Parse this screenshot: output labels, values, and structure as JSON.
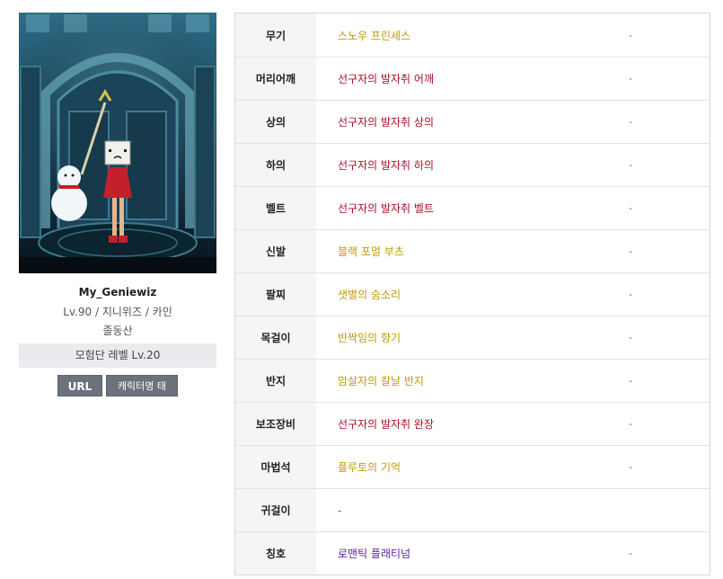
{
  "character": {
    "name": "My_Geniewiz",
    "info": "Lv.90 / 지니위즈 / 카인",
    "server": "졸동산",
    "adventure_level": "모험단 레벨 Lv.20",
    "url_button": "URL",
    "tag_button": "캐릭터명 태그"
  },
  "colors": {
    "unique": "#c19a07",
    "epic": "#a8102a",
    "title": "#5a1fa0"
  },
  "equipment": [
    {
      "slot": "무기",
      "item": "스노우 프린세스",
      "rarity": "unique",
      "extra": "-"
    },
    {
      "slot": "머리어깨",
      "item": "선구자의 발자취 어깨",
      "rarity": "epic",
      "extra": "-"
    },
    {
      "slot": "상의",
      "item": "선구자의 발자취 상의",
      "rarity": "epic",
      "extra": "-"
    },
    {
      "slot": "하의",
      "item": "선구자의 발자취 하의",
      "rarity": "epic",
      "extra": "-"
    },
    {
      "slot": "벨트",
      "item": "선구자의 발자취 벨트",
      "rarity": "epic",
      "extra": "-"
    },
    {
      "slot": "신발",
      "item": "블랙 포멀 부츠",
      "rarity": "unique",
      "extra": "-"
    },
    {
      "slot": "팔찌",
      "item": "샛별의 숨소리",
      "rarity": "unique",
      "extra": "-"
    },
    {
      "slot": "목걸이",
      "item": "반짝임의 향기",
      "rarity": "unique",
      "extra": "-"
    },
    {
      "slot": "반지",
      "item": "암살자의 칼날 반지",
      "rarity": "unique",
      "extra": "-"
    },
    {
      "slot": "보조장비",
      "item": "선구자의 발자취 완장",
      "rarity": "epic",
      "extra": "-"
    },
    {
      "slot": "마법석",
      "item": "플루토의 기억",
      "rarity": "unique",
      "extra": "-"
    },
    {
      "slot": "귀걸이",
      "item": "-",
      "rarity": "none",
      "extra": ""
    },
    {
      "slot": "칭호",
      "item": "로맨틱 플래티넘",
      "rarity": "title",
      "extra": "-"
    }
  ]
}
